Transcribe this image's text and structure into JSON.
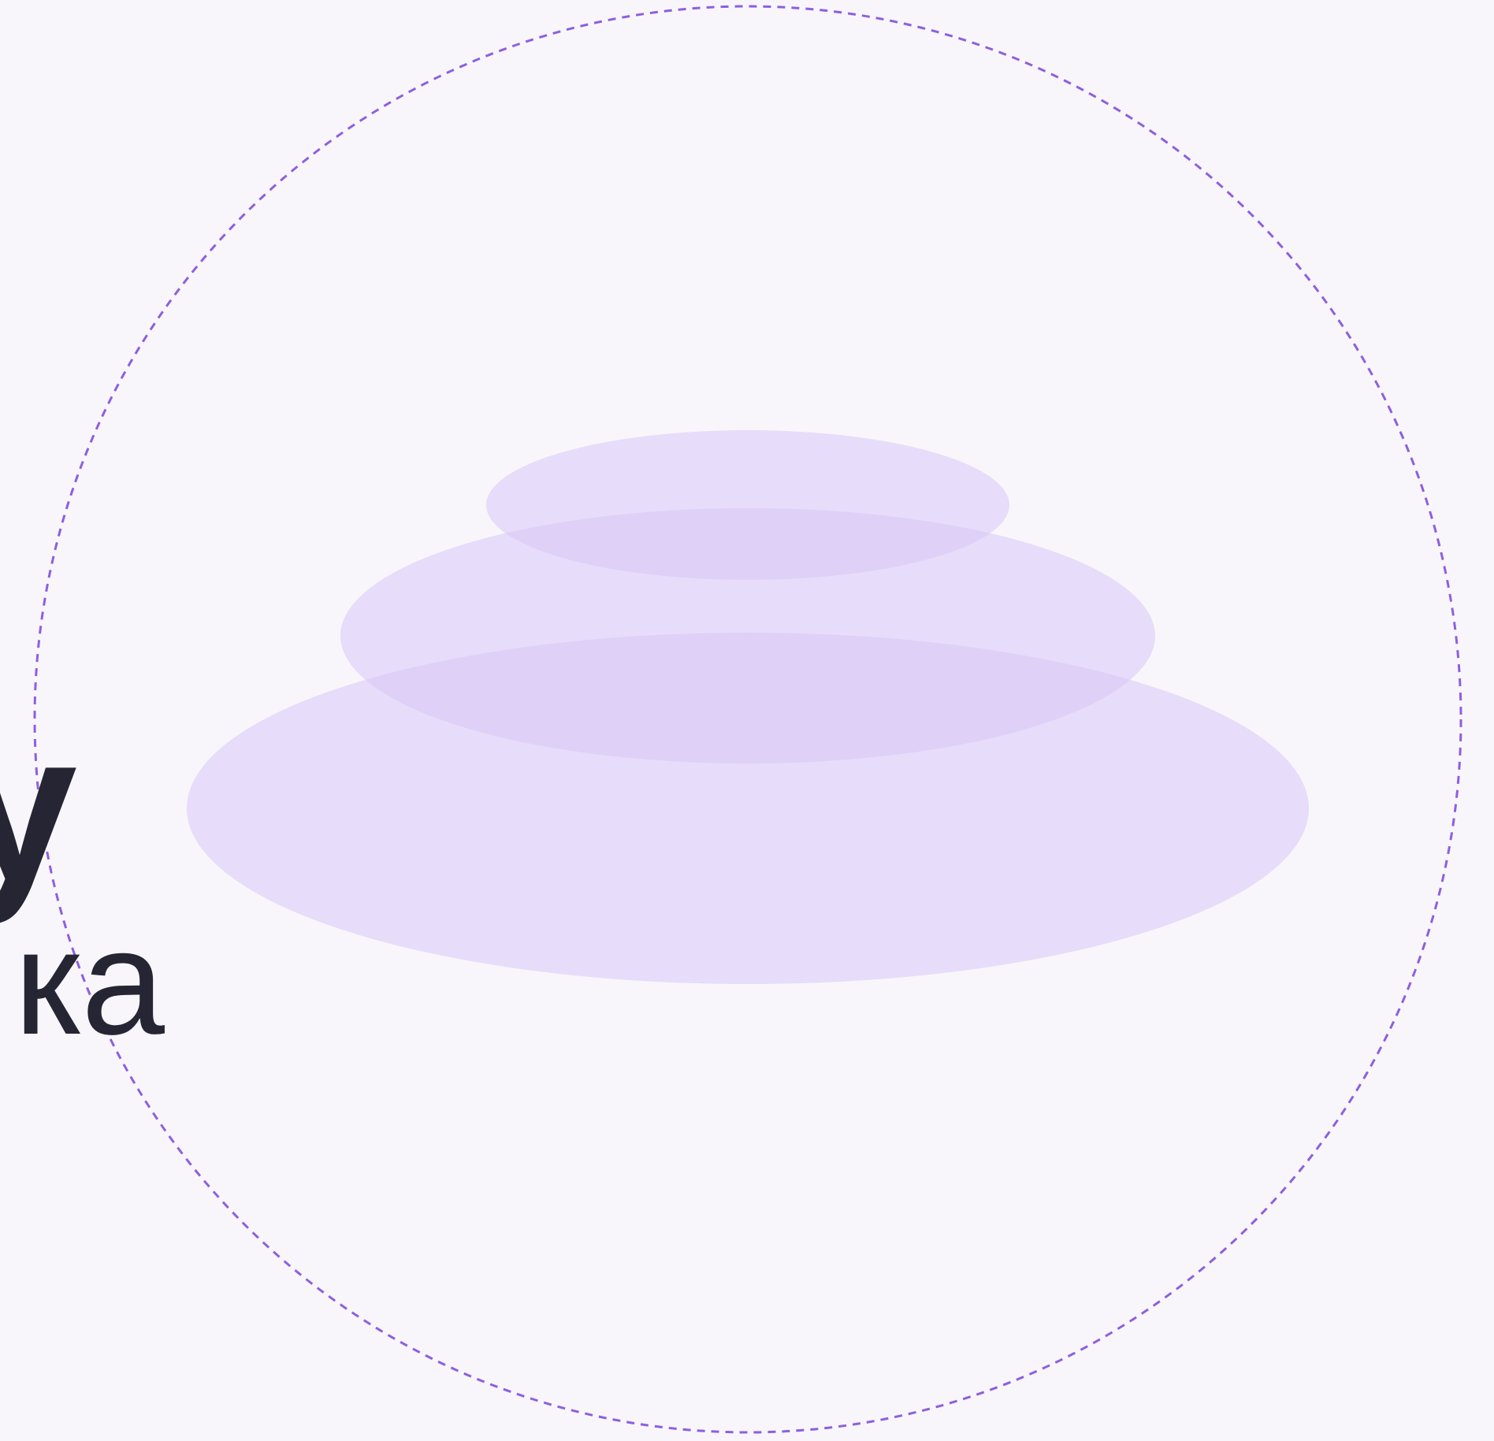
{
  "page": {
    "background_color": "#f8f6fb"
  },
  "text": {
    "partial_line_1": "у",
    "partial_line_2": "ка",
    "color": "#262533"
  },
  "decorations": {
    "dashed_circle": {
      "stroke_color": "#8d5fe0"
    },
    "stacked_ellipses": {
      "fill_color": "#d8c7f7",
      "count": 3
    }
  }
}
